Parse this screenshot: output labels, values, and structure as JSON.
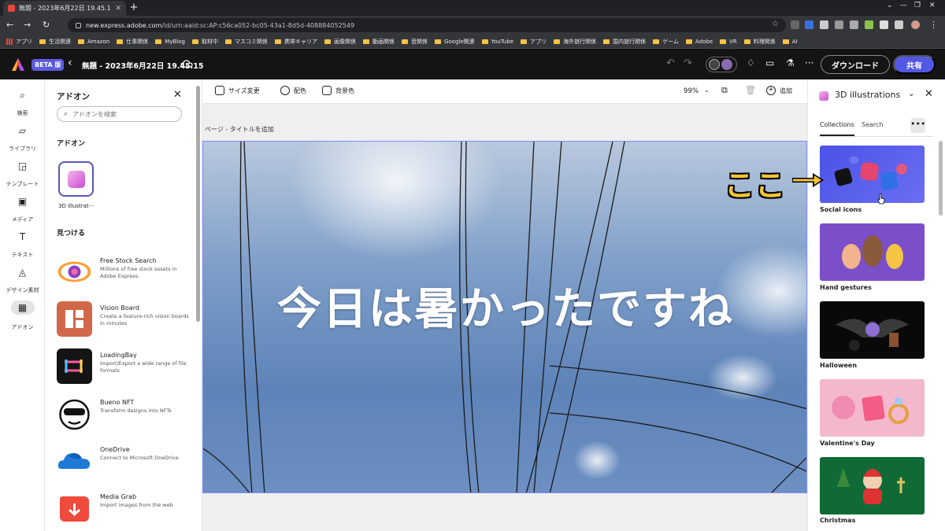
{
  "browser": {
    "tab_title": "無題 - 2023年6月22日 19.45.15",
    "url_host": "new.express.adobe.com",
    "url_path": "/id/urn:aaid:sc:AP:c56ca052-bc05-43a1-8d5d-408884052549",
    "bookmarks": [
      "アプリ",
      "生活関連",
      "Amazon",
      "仕事関係",
      "MyBlog",
      "取材中",
      "マスコミ関係",
      "携帯キャリア",
      "画像関係",
      "動画関係",
      "音関係",
      "Google関連",
      "YouTube",
      "アプリ",
      "海外旅行関係",
      "国内旅行関係",
      "ゲーム",
      "Adobe",
      "VR",
      "料理関係",
      "AI"
    ]
  },
  "appbar": {
    "beta": "BETA 版",
    "doc_title": "無題 - 2023年6月22日 19.45.15",
    "download": "ダウンロード",
    "share": "共有"
  },
  "rail": {
    "items": [
      {
        "label": "検索",
        "icon": "search-icon"
      },
      {
        "label": "ライブラリ",
        "icon": "folder-icon"
      },
      {
        "label": "テンプレート",
        "icon": "template-icon"
      },
      {
        "label": "メディア",
        "icon": "media-icon"
      },
      {
        "label": "テキスト",
        "icon": "text-icon"
      },
      {
        "label": "デザイン素材",
        "icon": "shapes-icon"
      },
      {
        "label": "アドオン",
        "icon": "addon-icon"
      }
    ]
  },
  "addons": {
    "title": "アドオン",
    "search_placeholder": "アドオンを検索",
    "section_installed": "アドオン",
    "installed_label": "3D illustrat···",
    "section_discover": "見つける",
    "items": [
      {
        "name": "Free Stock Search",
        "desc": "Millions of free stock assets in Adobe Express."
      },
      {
        "name": "Vision Board",
        "desc": "Create a feature-rich vision boards in minutes"
      },
      {
        "name": "LoadingBay",
        "desc": "Import/Export a wide range of file formats"
      },
      {
        "name": "Bueno NFT",
        "desc": "Transform designs into NFTs"
      },
      {
        "name": "OneDrive",
        "desc": "Connect to Microsoft OneDrive"
      },
      {
        "name": "Media Grab",
        "desc": "Import images from the web"
      }
    ]
  },
  "canvas": {
    "resize": "サイズ変更",
    "palette": "配色",
    "background": "背景色",
    "zoom": "99%",
    "add": "追加",
    "page_label": "ページ - タイトルを追加",
    "headline": "今日は暑かったですね"
  },
  "illustrations": {
    "title": "3D illustrations",
    "tab_collections": "Collections",
    "tab_search": "Search",
    "more": "•••",
    "cards": [
      "Social icons",
      "Hand gestures",
      "Halloween",
      "Valentine's Day",
      "Christmas"
    ]
  },
  "annotation": "ここ"
}
